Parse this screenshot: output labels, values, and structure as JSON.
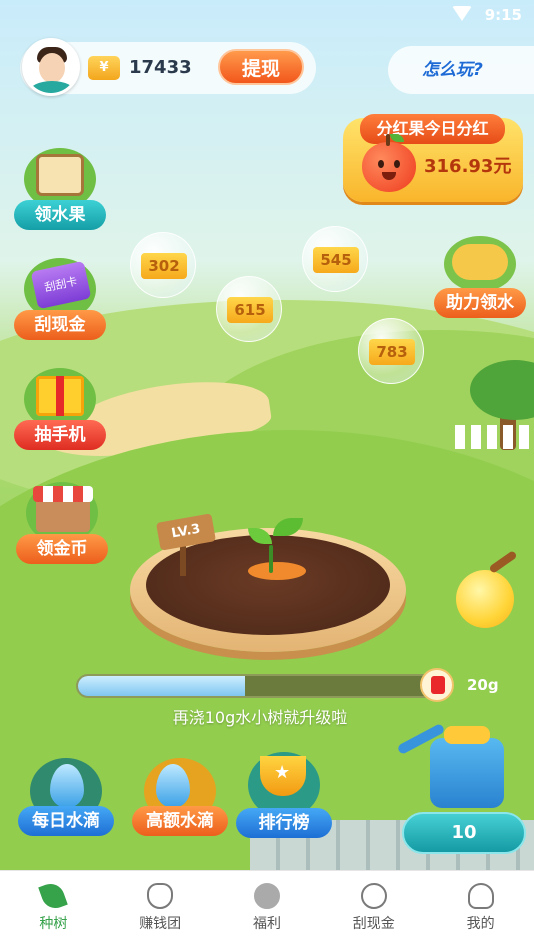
{
  "status": {
    "time": "9:15"
  },
  "user": {
    "coin_icon": "¥",
    "coins": "17433",
    "withdraw_label": "提现"
  },
  "howto_label": "怎么玩?",
  "dividend": {
    "title": "分红果今日分红",
    "amount": "316.93元"
  },
  "side_menu": [
    {
      "label": "领水果",
      "icon": "fruit-basket-icon"
    },
    {
      "label": "刮现金",
      "icon": "scratch-card-icon",
      "card_text": "刮刮卡"
    },
    {
      "label": "抽手机",
      "icon": "gift-box-icon"
    },
    {
      "label": "领金币",
      "icon": "shop-icon"
    }
  ],
  "bubbles": [
    "302",
    "545",
    "615",
    "783"
  ],
  "help_label": "助力领水",
  "tree": {
    "level": "LV.3"
  },
  "progress": {
    "fraction": 0.47,
    "target": "20g",
    "hint": "再浇10g水小树就升级啦"
  },
  "actions": [
    {
      "label": "每日水滴",
      "icon": "water-drop-icon"
    },
    {
      "label": "高额水滴",
      "icon": "water-drops-icon"
    },
    {
      "label": "排行榜",
      "icon": "trophy-icon"
    }
  ],
  "water_button": "10",
  "tabs": [
    {
      "label": "种树",
      "icon": "leaf-icon",
      "active": true
    },
    {
      "label": "赚钱团",
      "icon": "money-bag-icon"
    },
    {
      "label": "福利",
      "icon": "yen-icon"
    },
    {
      "label": "刮现金",
      "icon": "circle-icon"
    },
    {
      "label": "我的",
      "icon": "person-icon"
    }
  ],
  "colors": {
    "accent_green": "#36a24a",
    "withdraw_orange": "#f2561c",
    "teal": "#159ea6"
  }
}
